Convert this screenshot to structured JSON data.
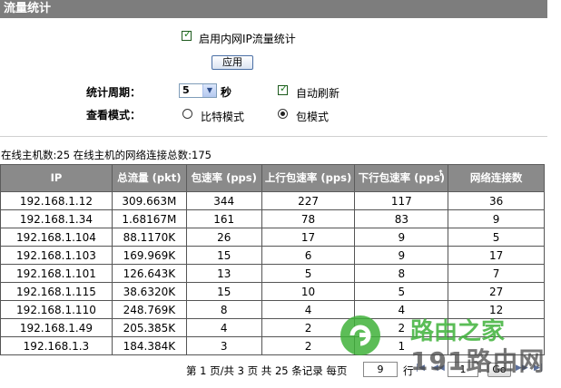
{
  "header": {
    "title": "流量统计"
  },
  "enable": {
    "label": "启用内网IP流量统计",
    "checked": true
  },
  "apply_label": "应用",
  "period": {
    "label": "统计周期：",
    "value": "5",
    "unit": "秒"
  },
  "auto_refresh": {
    "label": "自动刷新",
    "checked": true
  },
  "mode": {
    "label": "查看模式：",
    "options": [
      "比特模式",
      "包模式"
    ],
    "selected": "包模式"
  },
  "summary": {
    "text": "在线主机数:25   在线主机的网络连接总数:175"
  },
  "table": {
    "columns": [
      "IP",
      "总流量 (pkt)",
      "包速率 (pps)",
      "上行包速率 (pps)",
      "下行包速率 (pps)",
      "网络连接数"
    ],
    "rows": [
      [
        "192.168.1.12",
        "309.663M",
        "344",
        "227",
        "117",
        "36"
      ],
      [
        "192.168.1.34",
        "1.68167M",
        "161",
        "78",
        "83",
        "9"
      ],
      [
        "192.168.1.104",
        "88.1170K",
        "26",
        "17",
        "9",
        "5"
      ],
      [
        "192.168.1.103",
        "169.969K",
        "15",
        "6",
        "9",
        "17"
      ],
      [
        "192.168.1.101",
        "126.643K",
        "13",
        "5",
        "8",
        "7"
      ],
      [
        "192.168.1.115",
        "38.6320K",
        "15",
        "10",
        "5",
        "27"
      ],
      [
        "192.168.1.110",
        "248.769K",
        "8",
        "4",
        "4",
        "12"
      ],
      [
        "192.168.1.49",
        "205.385K",
        "4",
        "2",
        "2",
        ""
      ],
      [
        "192.168.1.3",
        "184.384K",
        "3",
        "2",
        "1",
        ""
      ]
    ]
  },
  "pager": {
    "text": "第 1 页/共 3 页 共 25 条记录 每页",
    "per_page": "9",
    "row_label": "行",
    "page_value": "1",
    "go_label": "Go"
  },
  "watermark": {
    "line1": "路由之家",
    "line2": "191路由网"
  },
  "icons": {
    "checkbox": "check-icon",
    "sort": "sort-up-icon",
    "dropdown": "chevron-down-icon"
  },
  "colors": {
    "header_bg": "#8a8a8a",
    "titlebar_bg": "#7d7d7d",
    "watermark_green": "#3fb23a"
  }
}
